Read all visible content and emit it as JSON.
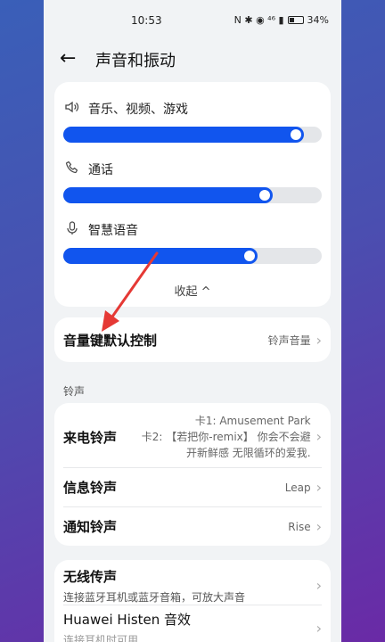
{
  "status_bar": {
    "time": "10:53",
    "battery": "34%",
    "icons": "N ✱ ◉ ⁴⁶ ▮"
  },
  "header": {
    "title": "声音和振动"
  },
  "volume": {
    "items": [
      {
        "label": "音乐、视频、游戏",
        "icon": "speaker-icon",
        "level": 0.93
      },
      {
        "label": "通话",
        "icon": "phone-icon",
        "level": 0.81
      },
      {
        "label": "智慧语音",
        "icon": "mic-icon",
        "level": 0.75
      }
    ],
    "collapse_label": "收起",
    "collapse_icon": "^"
  },
  "volume_key": {
    "label": "音量键默认控制",
    "value": "铃声音量"
  },
  "ringtone_section": {
    "label": "铃声"
  },
  "incoming_ring": {
    "label": "来电铃声",
    "value_line1": "卡1: Amusement Park",
    "value_line2": "卡2: 【若把你-remix】 你会不会避",
    "value_line3": "开新鲜感 无限循环的爱我."
  },
  "message_ring": {
    "label": "信息铃声",
    "value": "Leap"
  },
  "notify_ring": {
    "label": "通知铃声",
    "value": "Rise"
  },
  "wireless": {
    "label": "无线传声",
    "sub": "连接蓝牙耳机或蓝牙音箱，可放大声音"
  },
  "histen": {
    "label": "Huawei Histen 音效",
    "sub": "连接耳机时可用"
  },
  "colors": {
    "accent": "#1155ee",
    "arrow": "#e53935"
  }
}
